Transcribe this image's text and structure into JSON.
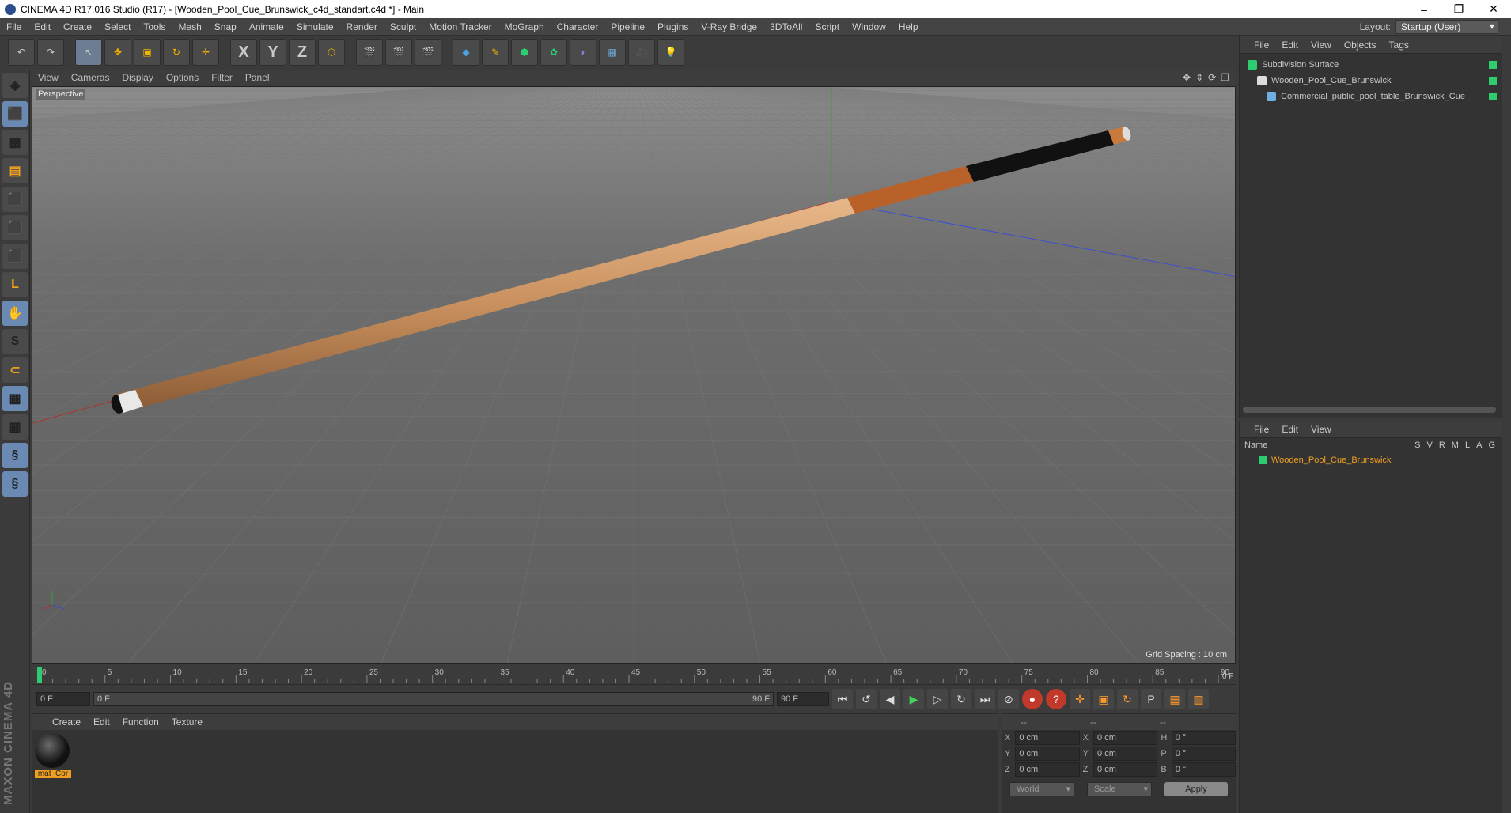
{
  "window": {
    "title": "CINEMA 4D R17.016 Studio (R17) - [Wooden_Pool_Cue_Brunswick_c4d_standart.c4d *] - Main",
    "minimize": "–",
    "maximize": "❐",
    "close": "✕"
  },
  "menu": [
    "File",
    "Edit",
    "Create",
    "Select",
    "Tools",
    "Mesh",
    "Snap",
    "Animate",
    "Simulate",
    "Render",
    "Sculpt",
    "Motion Tracker",
    "MoGraph",
    "Character",
    "Pipeline",
    "Plugins",
    "V-Ray Bridge",
    "3DToAll",
    "Script",
    "Window",
    "Help"
  ],
  "layout": {
    "label": "Layout:",
    "value": "Startup (User)"
  },
  "toolbar_axes": [
    "X",
    "Y",
    "Z"
  ],
  "viewport": {
    "menu": [
      "View",
      "Cameras",
      "Display",
      "Options",
      "Filter",
      "Panel"
    ],
    "camera_label": "Perspective",
    "grid_spacing": "Grid Spacing : 10 cm"
  },
  "timeline": {
    "ticks": [
      "0",
      "5",
      "10",
      "15",
      "20",
      "25",
      "30",
      "35",
      "40",
      "45",
      "50",
      "55",
      "60",
      "65",
      "70",
      "75",
      "80",
      "85",
      "90"
    ],
    "current_frame": "0 F",
    "start_field": "0 F",
    "range_start": "0 F",
    "range_end": "90 F",
    "end_field": "90 F"
  },
  "material_panel": {
    "menu": [
      "Create",
      "Edit",
      "Function",
      "Texture"
    ],
    "material_name": "mat_Cor"
  },
  "coords": {
    "header": [
      "--",
      "--",
      "--"
    ],
    "rows": [
      {
        "a1": "X",
        "v1": "0 cm",
        "a2": "X",
        "v2": "0 cm",
        "a3": "H",
        "v3": "0 °"
      },
      {
        "a1": "Y",
        "v1": "0 cm",
        "a2": "Y",
        "v2": "0 cm",
        "a3": "P",
        "v3": "0 °"
      },
      {
        "a1": "Z",
        "v1": "0 cm",
        "a2": "Z",
        "v2": "0 cm",
        "a3": "B",
        "v3": "0 °"
      }
    ],
    "world": "World",
    "scale": "Scale",
    "apply": "Apply"
  },
  "object_manager": {
    "menu": [
      "File",
      "Edit",
      "View",
      "Objects",
      "Tags"
    ],
    "objects": [
      {
        "name": "Subdivision Surface",
        "indent": 0
      },
      {
        "name": "Wooden_Pool_Cue_Brunswick",
        "indent": 1
      },
      {
        "name": "Commercial_public_pool_table_Brunswick_Cue",
        "indent": 2
      }
    ]
  },
  "layer_manager": {
    "menu": [
      "File",
      "Edit",
      "View"
    ],
    "name_header": "Name",
    "cols": [
      "S",
      "V",
      "R",
      "M",
      "L",
      "A",
      "G"
    ],
    "layers": [
      "Wooden_Pool_Cue_Brunswick"
    ]
  },
  "brand": "MAXON CINEMA 4D",
  "colors": {
    "accent": "#f0a020",
    "green": "#2ecc71",
    "viewport_bg": "#6a6a6a"
  }
}
